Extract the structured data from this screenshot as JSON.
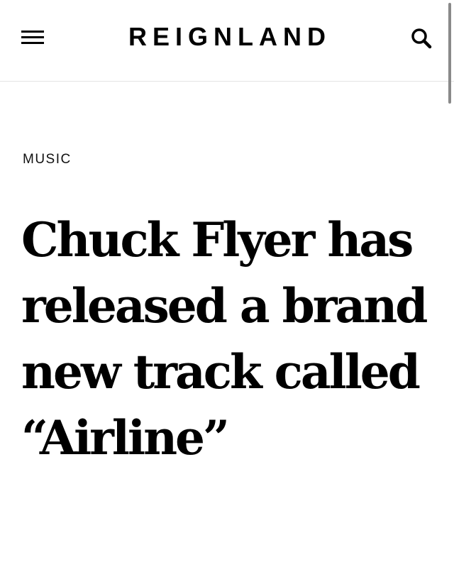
{
  "header": {
    "logo_text": "REIGNLAND",
    "menu_icon": "hamburger-menu-icon",
    "search_icon": "search-icon"
  },
  "article": {
    "category": "MUSIC",
    "headline": "Chuck Flyer has released a brand new track called “Airline”"
  }
}
